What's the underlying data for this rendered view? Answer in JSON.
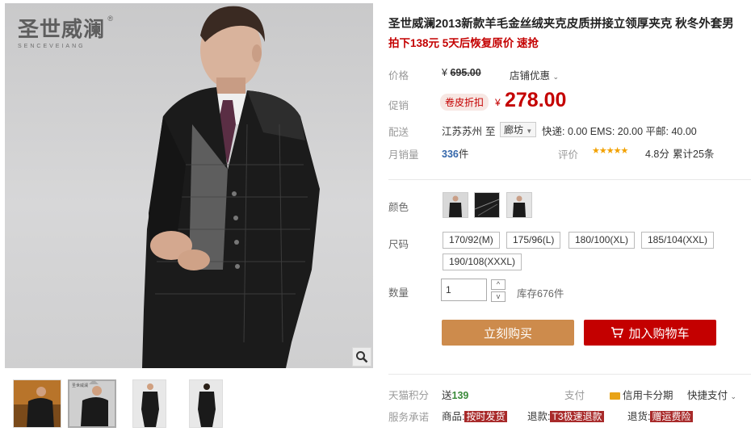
{
  "gallery": {
    "logo_cn": "圣世威澜",
    "logo_en": "SENCEVEIANG",
    "logo_reg": "®",
    "thumb_overlay": "圣世威澜"
  },
  "product": {
    "title": "圣世威澜2013新款羊毛金丝绒夹克皮质拼接立领厚夹克 秋冬外套男",
    "subtitle": "拍下138元 5天后恢复原价 速抢"
  },
  "price": {
    "label": "价格",
    "currency": "¥",
    "original": "695.00",
    "store_promo": "店铺优惠",
    "promo_label": "促销",
    "promo_badge": "卷皮折扣",
    "promo_price": "278.00"
  },
  "shipping": {
    "label": "配送",
    "from": "江苏苏州",
    "to_word": "至",
    "to_city": "廊坊",
    "fees": "快递: 0.00 EMS: 20.00 平邮: 40.00"
  },
  "sales": {
    "label": "月销量",
    "count": "336",
    "unit": "件",
    "rating_label": "评价",
    "stars": "★★★★★",
    "score": "4.8分",
    "review_total": "累计25条"
  },
  "color": {
    "label": "颜色"
  },
  "size": {
    "label": "尺码",
    "options": [
      "170/92(M)",
      "175/96(L)",
      "180/100(XL)",
      "185/104(XXL)",
      "190/108(XXXL)"
    ]
  },
  "quantity": {
    "label": "数量",
    "value": "1",
    "stock": "库存676件",
    "up": "^",
    "down": "v"
  },
  "actions": {
    "buy_now": "立刻购买",
    "add_cart": "加入购物车"
  },
  "points": {
    "label": "天猫积分",
    "prefix": "送",
    "value": "139",
    "pay_label": "支付",
    "credit": "信用卡分期",
    "quick_pay": "快捷支付"
  },
  "service": {
    "label": "服务承诺",
    "goods_label": "商品:",
    "goods_tag": "按时发货",
    "refund_label": "退款:",
    "refund_tag": "T3极速退款",
    "return_label": "退货:",
    "return_tag": "赠运费险"
  },
  "colors": {
    "accent": "#c40000",
    "buy_button": "#cd8b4c",
    "cart_button": "#c40000",
    "star": "#f2a100",
    "label_gray": "#999999",
    "link_blue": "#3366aa"
  }
}
